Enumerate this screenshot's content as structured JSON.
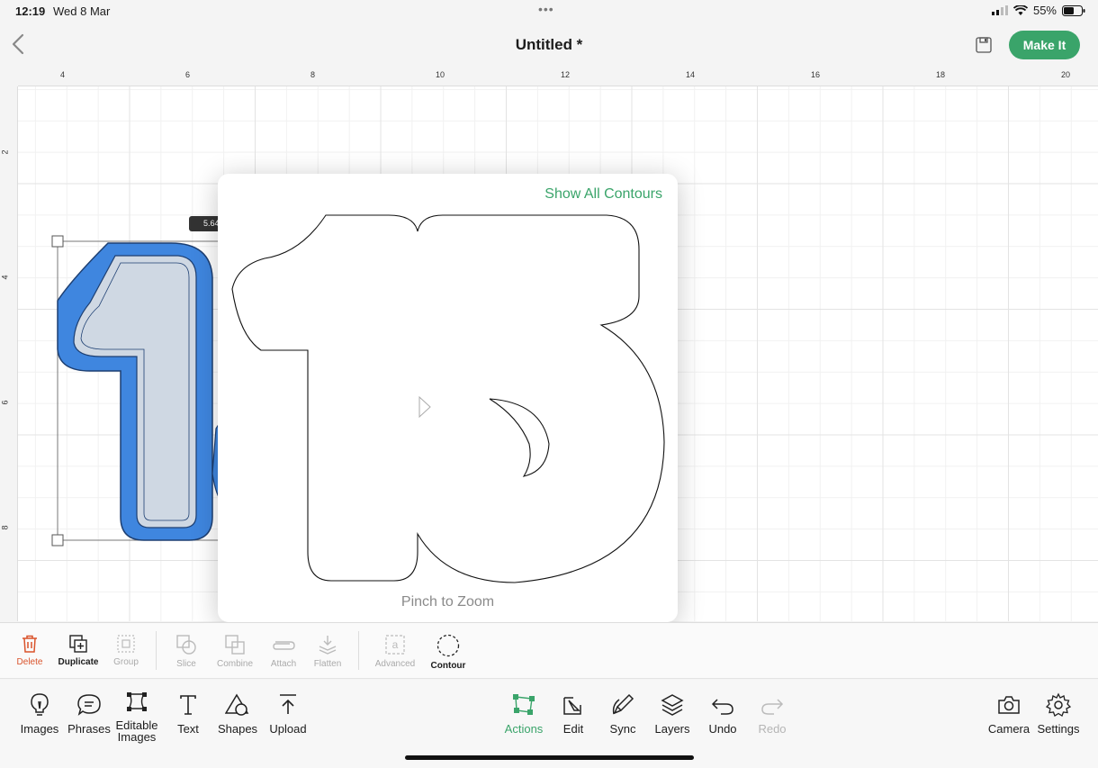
{
  "status_bar": {
    "time": "12:19",
    "date": "Wed 8 Mar",
    "battery": "55%"
  },
  "header": {
    "title": "Untitled *",
    "make_it_label": "Make It"
  },
  "ruler": {
    "top_ticks": [
      "4",
      "6",
      "8",
      "10",
      "12",
      "14",
      "16",
      "18",
      "20"
    ],
    "left_ticks": [
      "2",
      "4",
      "6",
      "8"
    ]
  },
  "canvas": {
    "dimension_label": "5.64"
  },
  "contour_panel": {
    "show_all_label": "Show All Contours",
    "hint": "Pinch to Zoom"
  },
  "action_bar": {
    "items": [
      {
        "label": "Delete",
        "icon": "trash-icon",
        "state": "active-red"
      },
      {
        "label": "Duplicate",
        "icon": "duplicate-icon",
        "state": "enabled"
      },
      {
        "label": "Group",
        "icon": "group-icon",
        "state": "disabled"
      },
      {
        "label": "Slice",
        "icon": "slice-icon",
        "state": "disabled"
      },
      {
        "label": "Combine",
        "icon": "combine-icon",
        "state": "disabled"
      },
      {
        "label": "Attach",
        "icon": "attach-icon",
        "state": "disabled"
      },
      {
        "label": "Flatten",
        "icon": "flatten-icon",
        "state": "disabled"
      },
      {
        "label": "Advanced",
        "icon": "advanced-icon",
        "state": "disabled"
      },
      {
        "label": "Contour",
        "icon": "contour-icon",
        "state": "selected"
      }
    ]
  },
  "tab_bar": {
    "left": [
      {
        "label": "Images",
        "icon": "lightbulb-icon"
      },
      {
        "label": "Phrases",
        "icon": "speech-bubble-icon"
      },
      {
        "label": "Editable\nImages",
        "icon": "editable-images-icon"
      },
      {
        "label": "Text",
        "icon": "text-icon"
      },
      {
        "label": "Shapes",
        "icon": "shapes-icon"
      },
      {
        "label": "Upload",
        "icon": "upload-icon"
      }
    ],
    "center": [
      {
        "label": "Actions",
        "icon": "actions-icon",
        "state": "active"
      },
      {
        "label": "Edit",
        "icon": "edit-icon"
      },
      {
        "label": "Sync",
        "icon": "sync-icon"
      },
      {
        "label": "Layers",
        "icon": "layers-icon"
      },
      {
        "label": "Undo",
        "icon": "undo-icon"
      },
      {
        "label": "Redo",
        "icon": "redo-icon",
        "state": "disabled"
      }
    ],
    "right": [
      {
        "label": "Camera",
        "icon": "camera-icon"
      },
      {
        "label": "Settings",
        "icon": "settings-icon"
      }
    ]
  },
  "colors": {
    "accent_green": "#3aa46a",
    "delete_red": "#d9532b",
    "shape_blue": "#3f86df"
  }
}
